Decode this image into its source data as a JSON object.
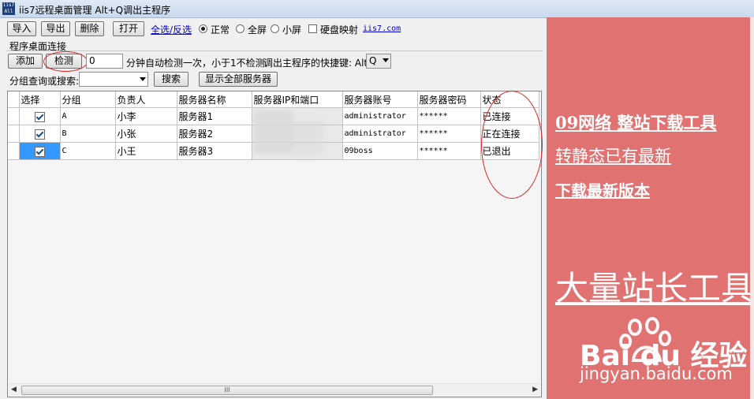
{
  "window": {
    "title": "iis7远程桌面管理 Alt+Q调出主程序",
    "icon_text": "iis7 All"
  },
  "toolbar": {
    "import": "导入",
    "export": "导出",
    "delete": "删除",
    "open": "打开",
    "select_toggle": "全选/反选",
    "radio_normal": "正常",
    "radio_full": "全屏",
    "radio_small": "小屏",
    "disk_map": "硬盘映射",
    "site_link": "iis7.com"
  },
  "section": {
    "title": "程序桌面连接",
    "add": "添加",
    "check": "检测",
    "interval_value": "0",
    "interval_text": "分钟自动检测一次，小于1不检测",
    "hotkey_label": "调出主程序的快捷键: Alt",
    "hotkey_value": "Q"
  },
  "search": {
    "label": "分组查询或搜索:",
    "search_button": "搜索",
    "show_all": "显示全部服务器"
  },
  "table": {
    "headers": [
      "选择",
      "分组",
      "负责人",
      "服务器名称",
      "服务器IP和端口",
      "服务器账号",
      "服务器密码",
      "状态"
    ],
    "rows": [
      {
        "group": "A",
        "owner": "小李",
        "name": "服务器1",
        "ip": "",
        "account": "administrator",
        "password": "******",
        "status": "已连接"
      },
      {
        "group": "B",
        "owner": "小张",
        "name": "服务器2",
        "ip": "",
        "account": "administrator",
        "password": "******",
        "status": "正在连接"
      },
      {
        "group": "C",
        "owner": "小王",
        "name": "服务器3",
        "ip": "",
        "account": "09boss",
        "password": "******",
        "status": "已退出"
      }
    ]
  },
  "scrollbar": {
    "grip": "III"
  },
  "ad": {
    "line1": "09网络 整站下载工具",
    "line2": "转静态已有最新",
    "line3": "下载最新版本",
    "line4": "大量站长工具",
    "watermark_logo": "Bai du 经验",
    "watermark_url": "jingyan.baidu.com"
  },
  "colors": {
    "ad_bg": "#e07272",
    "selection": "#3399ff",
    "link": "#0000cc",
    "annotation": "#e02020"
  }
}
